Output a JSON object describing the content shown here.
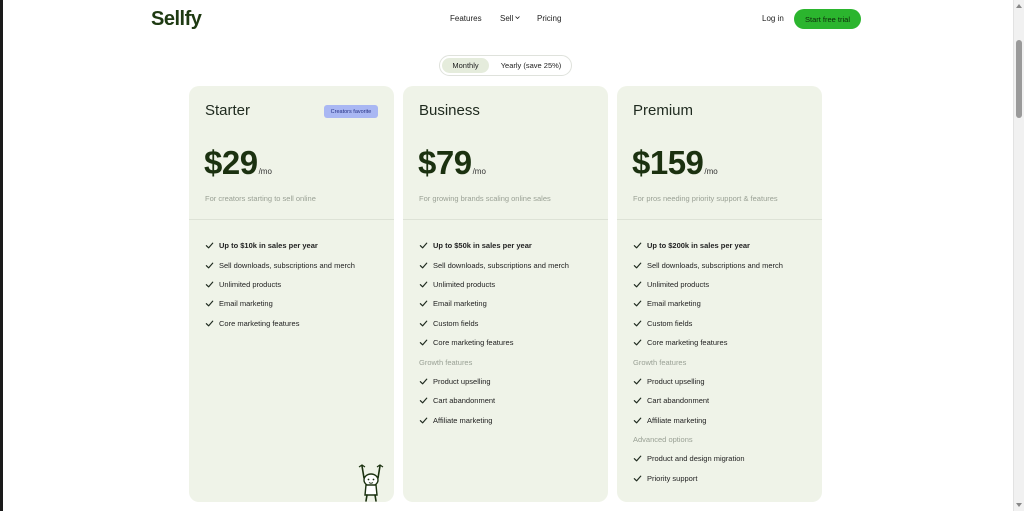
{
  "header": {
    "logo": "Sellfy",
    "nav": {
      "features": "Features",
      "sell": "Sell",
      "pricing": "Pricing"
    },
    "login": "Log in",
    "cta": "Start free trial"
  },
  "billing_toggle": {
    "monthly": "Monthly",
    "yearly": "Yearly (save 25%)",
    "selected": "Monthly"
  },
  "plans": [
    {
      "name": "Starter",
      "badge": "Creators favorite",
      "price": "$29",
      "per": "/mo",
      "description": "For creators starting to sell online",
      "features": [
        "Up to $10k in sales per year",
        "Sell downloads, subscriptions and merch",
        "Unlimited products",
        "Email marketing",
        "Core marketing features"
      ]
    },
    {
      "name": "Business",
      "price": "$79",
      "per": "/mo",
      "description": "For growing brands scaling online sales",
      "features": [
        "Up to $50k in sales per year",
        "Sell downloads, subscriptions and merch",
        "Unlimited products",
        "Email marketing",
        "Custom fields",
        "Core marketing features"
      ],
      "growth_heading": "Growth features",
      "growth_features": [
        "Product upselling",
        "Cart abandonment",
        "Affiliate marketing"
      ]
    },
    {
      "name": "Premium",
      "price": "$159",
      "per": "/mo",
      "description": "For pros needing priority support & features",
      "features": [
        "Up to $200k in sales per year",
        "Sell downloads, subscriptions and merch",
        "Unlimited products",
        "Email marketing",
        "Custom fields",
        "Core marketing features"
      ],
      "growth_heading": "Growth features",
      "growth_features": [
        "Product upselling",
        "Cart abandonment",
        "Affiliate marketing"
      ],
      "advanced_heading": "Advanced options",
      "advanced_features": [
        "Product and design migration",
        "Priority support"
      ]
    }
  ],
  "icons": {
    "check": "check-icon",
    "chevron": "chevron-down-icon",
    "mascot": "mascot-illustration"
  },
  "colors": {
    "brand": "#1e3a12",
    "cta": "#2bb52e",
    "card_bg": "#eff3e8",
    "badge": "#a9b7f3",
    "toggle_active": "#e5ecdc"
  }
}
